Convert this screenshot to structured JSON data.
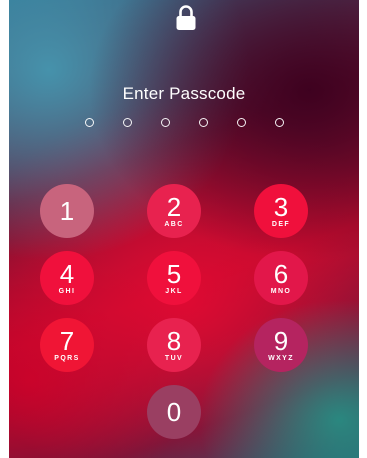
{
  "lock_screen": {
    "lock_icon": "lock-icon",
    "title": "Enter Passcode",
    "passcode_length": 6,
    "entered_digits": 0
  },
  "keypad": {
    "keys": [
      {
        "digit": "1",
        "letters": "",
        "color": "#c8647d"
      },
      {
        "digit": "2",
        "letters": "ABC",
        "color": "#e8224f"
      },
      {
        "digit": "3",
        "letters": "DEF",
        "color": "#f0103c"
      },
      {
        "digit": "4",
        "letters": "GHI",
        "color": "#f0103c"
      },
      {
        "digit": "5",
        "letters": "JKL",
        "color": "#f0103c"
      },
      {
        "digit": "6",
        "letters": "MNO",
        "color": "#e2174a"
      },
      {
        "digit": "7",
        "letters": "PQRS",
        "color": "#f01535"
      },
      {
        "digit": "8",
        "letters": "TUV",
        "color": "#e8224f"
      },
      {
        "digit": "9",
        "letters": "WXYZ",
        "color": "#b52460"
      },
      {
        "digit": "0",
        "letters": "",
        "color": "#9a3f62"
      }
    ]
  }
}
